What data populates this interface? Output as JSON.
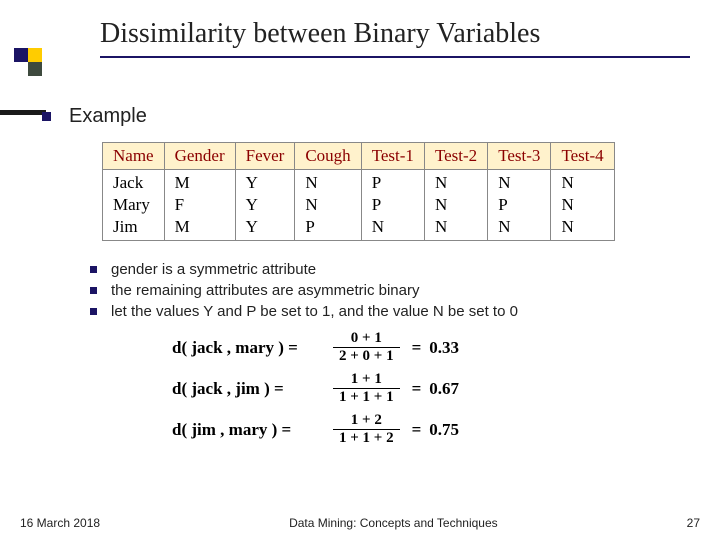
{
  "title": "Dissimilarity between Binary Variables",
  "main_bullet": "Example",
  "table": {
    "headers": [
      "Name",
      "Gender",
      "Fever",
      "Cough",
      "Test-1",
      "Test-2",
      "Test-3",
      "Test-4"
    ],
    "rows": [
      [
        "Jack",
        "M",
        "Y",
        "N",
        "P",
        "N",
        "N",
        "N"
      ],
      [
        "Mary",
        "F",
        "Y",
        "N",
        "P",
        "N",
        "P",
        "N"
      ],
      [
        "Jim",
        "M",
        "Y",
        "P",
        "N",
        "N",
        "N",
        "N"
      ]
    ]
  },
  "sub_bullets": [
    "gender is a symmetric attribute",
    "the remaining attributes are asymmetric binary",
    "let the values Y and P be set to 1, and the value N be set to 0"
  ],
  "equations": [
    {
      "lhs": "d( jack , mary ) =",
      "num": "0 + 1",
      "den": "2 + 0 + 1",
      "result": "0.33"
    },
    {
      "lhs": "d( jack , jim ) =",
      "num": "1 + 1",
      "den": "1 + 1 + 1",
      "result": "0.67"
    },
    {
      "lhs": "d( jim , mary ) =",
      "num": "1 + 2",
      "den": "1 + 1 + 2",
      "result": "0.75"
    }
  ],
  "footer": {
    "date": "16 March 2018",
    "center": "Data Mining: Concepts and Techniques",
    "page": "27"
  }
}
